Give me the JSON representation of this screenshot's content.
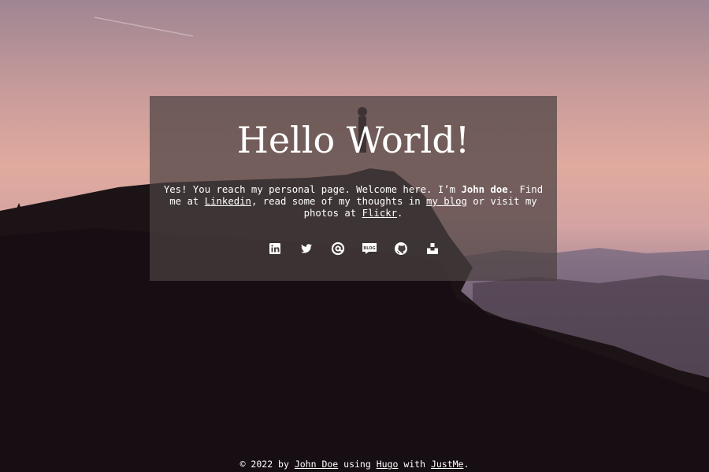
{
  "card": {
    "title": "Hello World!",
    "intro": {
      "before_name": "Yes! You reach my personal page. Welcome here. I’m ",
      "name": "John doe",
      "after_name": ". Find me at ",
      "linkedin_link": "Linkedin",
      "mid_text": ", read some of my thoughts in ",
      "blog_link": "my blog",
      "after_blog": " or visit my photos at ",
      "flickr_link": "Flickr",
      "end": "."
    },
    "social_icons": [
      "linkedin-icon",
      "twitter-icon",
      "email-icon",
      "blog-icon",
      "github-icon",
      "unsplash-icon"
    ],
    "blog_icon_text": "BLOG"
  },
  "footer": {
    "prefix": "© 2022 by ",
    "author_link": "John Doe",
    "using": " using ",
    "hugo_link": "Hugo",
    "with": " with ",
    "theme_link": "JustMe",
    "end": "."
  }
}
